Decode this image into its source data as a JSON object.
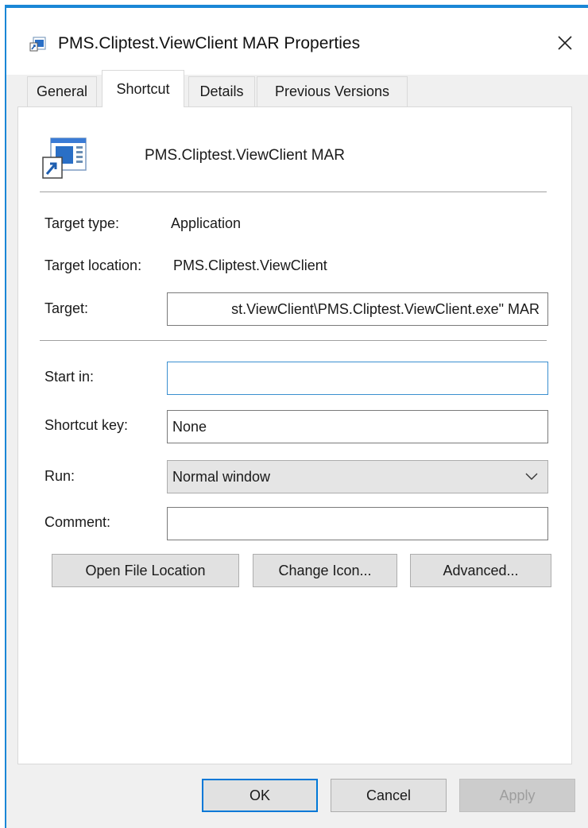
{
  "window": {
    "title": "PMS.Cliptest.ViewClient MAR Properties",
    "close_glyph": "✕",
    "accent": "#1a87d6"
  },
  "tabs": [
    {
      "label": "General",
      "active": false
    },
    {
      "label": "Shortcut",
      "active": true
    },
    {
      "label": "Details",
      "active": false
    },
    {
      "label": "Previous Versions",
      "active": false
    }
  ],
  "shortcut": {
    "name": "PMS.Cliptest.ViewClient MAR",
    "target_type_label": "Target type:",
    "target_type_value": "Application",
    "target_location_label": "Target location:",
    "target_location_value": "PMS.Cliptest.ViewClient",
    "target_label": "Target:",
    "target_value": "st.ViewClient\\PMS.Cliptest.ViewClient.exe\" MAR",
    "start_in_label": "Start in:",
    "start_in_value": "",
    "shortcut_key_label": "Shortcut key:",
    "shortcut_key_value": "None",
    "run_label": "Run:",
    "run_value": "Normal window",
    "comment_label": "Comment:",
    "comment_value": ""
  },
  "action_buttons": {
    "open_file_location": "Open File Location",
    "change_icon": "Change Icon...",
    "advanced": "Advanced..."
  },
  "dialog_buttons": {
    "ok": "OK",
    "cancel": "Cancel",
    "apply": "Apply"
  }
}
